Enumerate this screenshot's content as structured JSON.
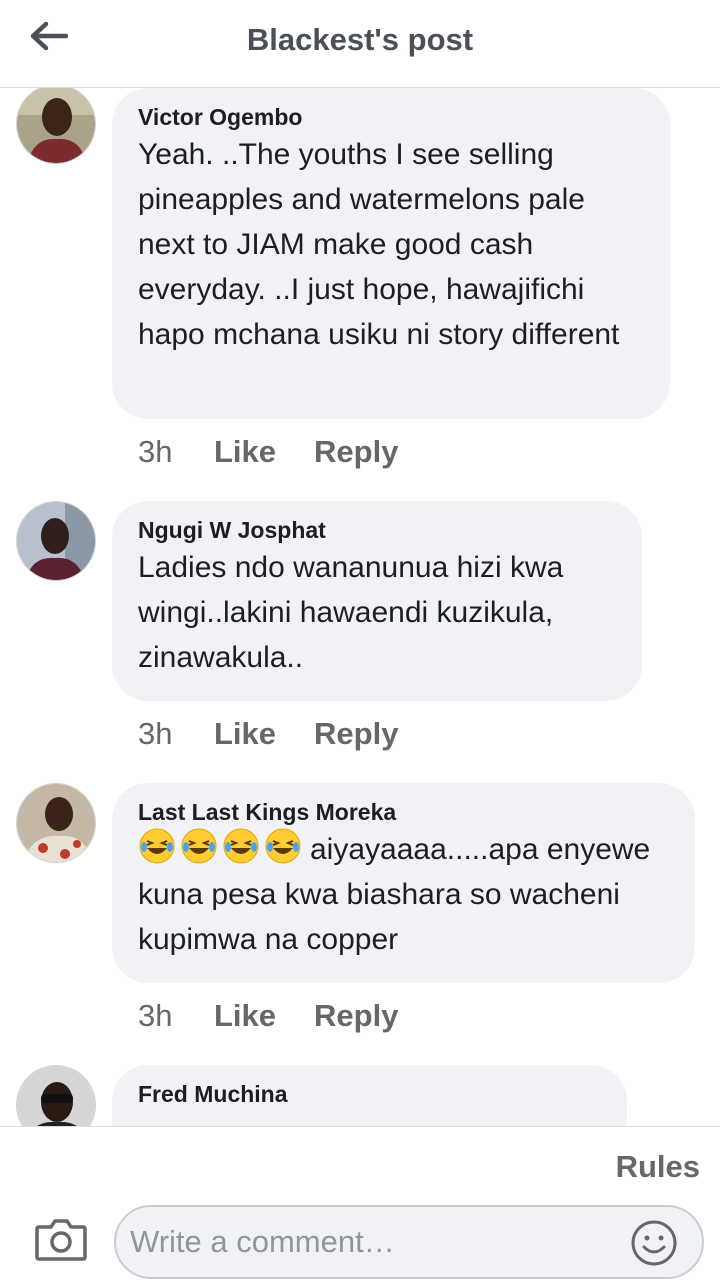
{
  "header": {
    "title": "Blackest's post",
    "back_icon": "arrow-left-icon"
  },
  "comments": [
    {
      "author": "Victor Ogembo",
      "text": "Yeah. ..The youths I see selling pineapples and watermelons pale next to JIAM make good cash everyday. ..I just hope, hawajifichi hapo mchana usiku ni story different",
      "time": "3h",
      "like_label": "Like",
      "reply_label": "Reply"
    },
    {
      "author": "Ngugi W Josphat",
      "text": "Ladies ndo wananunua hizi kwa wingi..lakini hawaendi kuzikula, zinawakula..",
      "time": "3h",
      "like_label": "Like",
      "reply_label": "Reply"
    },
    {
      "author": "Last Last Kings Moreka",
      "emoji": "😂😂😂😂",
      "text": "aiyayaaaa.....apa enyewe kuna pesa kwa biashara so wacheni kupimwa na copper",
      "time": "3h",
      "like_label": "Like",
      "reply_label": "Reply"
    },
    {
      "author": "Fred Muchina"
    }
  ],
  "footer": {
    "rules_label": "Rules",
    "input_placeholder": "Write a comment…",
    "camera_icon": "camera-icon",
    "smiley_icon": "smiley-icon"
  }
}
